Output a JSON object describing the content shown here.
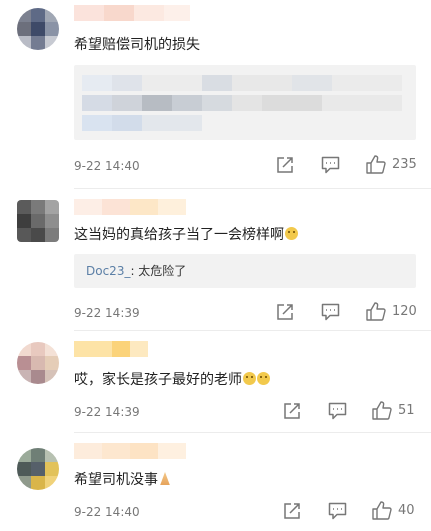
{
  "comments": [
    {
      "text": "希望赔偿司机的损失",
      "time": "9-22 14:40",
      "likes": "235"
    },
    {
      "text": "这当妈的真给孩子当了一会榜样啊",
      "quote": {
        "user": "Doc23_",
        "text": ": 太危险了"
      },
      "time": "9-22 14:39",
      "likes": "120"
    },
    {
      "text": "哎，家长是孩子最好的老师",
      "time": "9-22 14:39",
      "likes": "51"
    },
    {
      "text": "希望司机没事",
      "time": "9-22 14:40",
      "likes": "40"
    }
  ],
  "icons": {
    "share": "share-icon",
    "comment": "comment-icon",
    "like": "thumbs-up-icon"
  },
  "colors": {
    "quote_user": "#5b7fa6",
    "meta": "#777777",
    "quote_bg": "#f2f2f2"
  }
}
